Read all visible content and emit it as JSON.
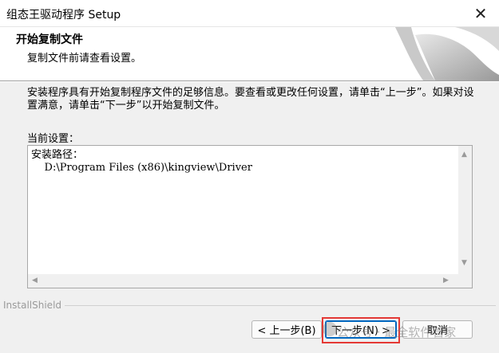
{
  "window": {
    "title": "组态王驱动程序 Setup",
    "close_glyph": "✕"
  },
  "header": {
    "title": "开始复制文件",
    "subtitle": "复制文件前请查看设置。"
  },
  "info": {
    "text": "安装程序具有开始复制程序文件的足够信息。要查看或更改任何设置，请单击“上一步”。如果对设置满意，请单击“下一步”以开始复制文件。"
  },
  "current_settings": {
    "label": "当前设置：",
    "content": "安装路径：\n    D:\\Program Files (x86)\\kingview\\Driver"
  },
  "footer": {
    "brand": "InstallShield"
  },
  "buttons": {
    "back": "< 上一步(B)",
    "next": "下一步(N) >",
    "cancel": "取消"
  },
  "watermark": {
    "text": "公众号 · 最全软件管家"
  },
  "colors": {
    "accent": "#0067c0",
    "highlight": "#e53935"
  }
}
